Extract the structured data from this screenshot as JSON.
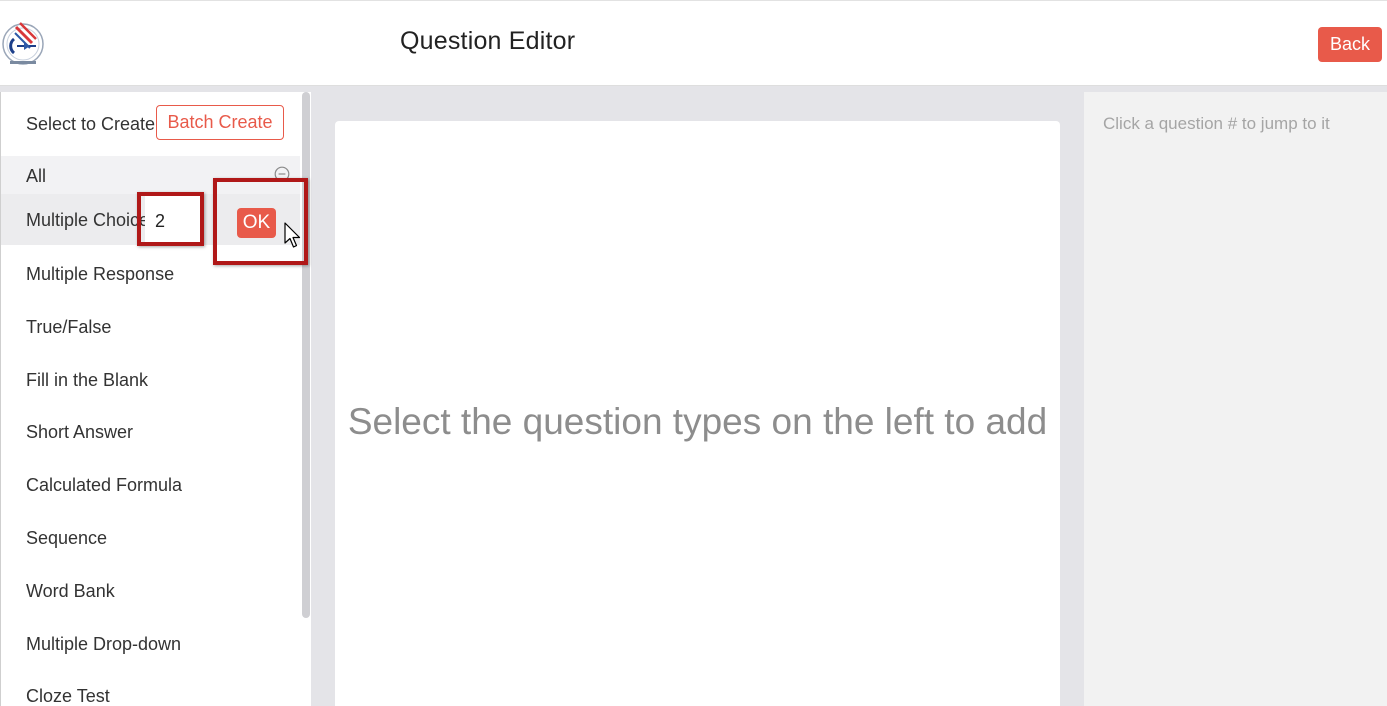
{
  "header": {
    "title": "Question Editor",
    "back_label": "Back"
  },
  "left_panel": {
    "create_label": "Select to Create",
    "batch_create_label": "Batch Create",
    "all_label": "All",
    "active_type": "Multiple Choice",
    "quantity_input_value": "2",
    "ok_label": "OK",
    "question_types": [
      "Multiple Response",
      "True/False",
      "Fill in the Blank",
      "Short Answer",
      "Calculated Formula",
      "Sequence",
      "Word Bank",
      "Multiple Drop-down",
      "Cloze Test"
    ]
  },
  "main": {
    "empty_message": "Select the question types on the left to add"
  },
  "right_panel": {
    "hint": "Click a question # to jump to it"
  },
  "colors": {
    "accent": "#e85a4a",
    "highlight_box": "#b01818",
    "background_gray": "#e4e4e8"
  },
  "icons": {
    "logo": "logo-emblem",
    "collapse": "minus-circle-icon",
    "cursor": "mouse-pointer-icon"
  }
}
